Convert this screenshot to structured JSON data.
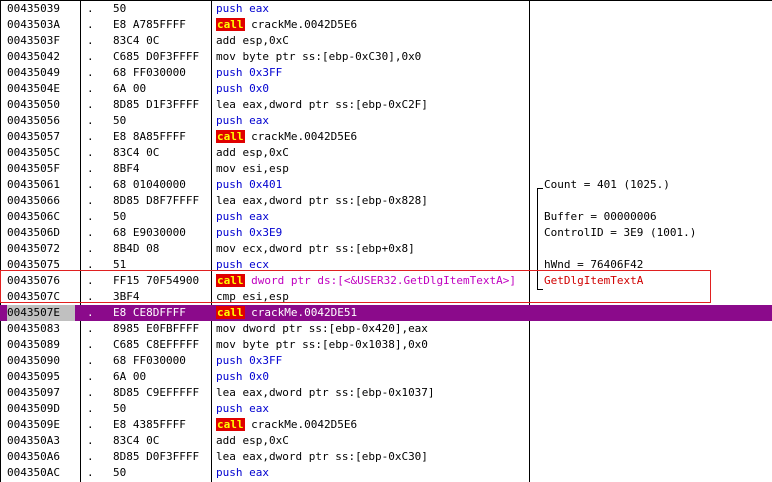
{
  "rows": [
    {
      "addr": "00435039",
      "mark": ".",
      "hex": "50",
      "mn": "push",
      "ops": "eax",
      "kind": "push"
    },
    {
      "addr": "0043503A",
      "mark": ".",
      "hex": "E8 A785FFFF",
      "mn": "call",
      "ops": "crackMe.0042D5E6",
      "kind": "call"
    },
    {
      "addr": "0043503F",
      "mark": ".",
      "hex": "83C4 0C",
      "mn": "add",
      "ops": "esp,0xC",
      "kind": "normal"
    },
    {
      "addr": "00435042",
      "mark": ".",
      "hex": "C685 D0F3FFFF",
      "mn": "mov",
      "ops": "byte ptr ss:[ebp-0xC30],0x0",
      "kind": "normal"
    },
    {
      "addr": "00435049",
      "mark": ".",
      "hex": "68 FF030000",
      "mn": "push",
      "ops": "0x3FF",
      "kind": "push"
    },
    {
      "addr": "0043504E",
      "mark": ".",
      "hex": "6A 00",
      "mn": "push",
      "ops": "0x0",
      "kind": "push"
    },
    {
      "addr": "00435050",
      "mark": ".",
      "hex": "8D85 D1F3FFFF",
      "mn": "lea",
      "ops": "eax,dword ptr ss:[ebp-0xC2F]",
      "kind": "normal"
    },
    {
      "addr": "00435056",
      "mark": ".",
      "hex": "50",
      "mn": "push",
      "ops": "eax",
      "kind": "push"
    },
    {
      "addr": "00435057",
      "mark": ".",
      "hex": "E8 8A85FFFF",
      "mn": "call",
      "ops": "crackMe.0042D5E6",
      "kind": "call"
    },
    {
      "addr": "0043505C",
      "mark": ".",
      "hex": "83C4 0C",
      "mn": "add",
      "ops": "esp,0xC",
      "kind": "normal"
    },
    {
      "addr": "0043505F",
      "mark": ".",
      "hex": "8BF4",
      "mn": "mov",
      "ops": "esi,esp",
      "kind": "normal"
    },
    {
      "addr": "00435061",
      "mark": ".",
      "hex": "68 01040000",
      "mn": "push",
      "ops": "0x401",
      "kind": "push",
      "comment": "Count = 401 (1025.)"
    },
    {
      "addr": "00435066",
      "mark": ".",
      "hex": "8D85 D8F7FFFF",
      "mn": "lea",
      "ops": "eax,dword ptr ss:[ebp-0x828]",
      "kind": "normal"
    },
    {
      "addr": "0043506C",
      "mark": ".",
      "hex": "50",
      "mn": "push",
      "ops": "eax",
      "kind": "push",
      "comment": "Buffer = 00000006"
    },
    {
      "addr": "0043506D",
      "mark": ".",
      "hex": "68 E9030000",
      "mn": "push",
      "ops": "0x3E9",
      "kind": "push",
      "comment": "ControlID = 3E9 (1001.)"
    },
    {
      "addr": "00435072",
      "mark": ".",
      "hex": "8B4D 08",
      "mn": "mov",
      "ops": "ecx,dword ptr ss:[ebp+0x8]",
      "kind": "normal"
    },
    {
      "addr": "00435075",
      "mark": ".",
      "hex": "51",
      "mn": "push",
      "ops": "ecx",
      "kind": "push",
      "comment": "hWnd = 76406F42"
    },
    {
      "addr": "00435076",
      "mark": ".",
      "hex": "FF15 70F54900",
      "mn": "call",
      "ops": "dword ptr ds:[<&USER32.GetDlgItemTextA>]",
      "kind": "call-api",
      "comment": "GetDlgItemTextA",
      "comment_kind": "api"
    },
    {
      "addr": "0043507C",
      "mark": ".",
      "hex": "3BF4",
      "mn": "cmp",
      "ops": "esi,esp",
      "kind": "normal"
    },
    {
      "addr": "0043507E",
      "mark": ".",
      "hex": "E8 CE8DFFFF",
      "mn": "call",
      "ops": "crackMe.0042DE51",
      "kind": "call",
      "selected": true
    },
    {
      "addr": "00435083",
      "mark": ".",
      "hex": "8985 E0FBFFFF",
      "mn": "mov",
      "ops": "dword ptr ss:[ebp-0x420],eax",
      "kind": "normal"
    },
    {
      "addr": "00435089",
      "mark": ".",
      "hex": "C685 C8EFFFFF",
      "mn": "mov",
      "ops": "byte ptr ss:[ebp-0x1038],0x0",
      "kind": "normal"
    },
    {
      "addr": "00435090",
      "mark": ".",
      "hex": "68 FF030000",
      "mn": "push",
      "ops": "0x3FF",
      "kind": "push"
    },
    {
      "addr": "00435095",
      "mark": ".",
      "hex": "6A 00",
      "mn": "push",
      "ops": "0x0",
      "kind": "push"
    },
    {
      "addr": "00435097",
      "mark": ".",
      "hex": "8D85 C9EFFFFF",
      "mn": "lea",
      "ops": "eax,dword ptr ss:[ebp-0x1037]",
      "kind": "normal"
    },
    {
      "addr": "0043509D",
      "mark": ".",
      "hex": "50",
      "mn": "push",
      "ops": "eax",
      "kind": "push"
    },
    {
      "addr": "0043509E",
      "mark": ".",
      "hex": "E8 4385FFFF",
      "mn": "call",
      "ops": "crackMe.0042D5E6",
      "kind": "call"
    },
    {
      "addr": "004350A3",
      "mark": ".",
      "hex": "83C4 0C",
      "mn": "add",
      "ops": "esp,0xC",
      "kind": "normal"
    },
    {
      "addr": "004350A6",
      "mark": ".",
      "hex": "8D85 D0F3FFFF",
      "mn": "lea",
      "ops": "eax,dword ptr ss:[ebp-0xC30]",
      "kind": "normal"
    },
    {
      "addr": "004350AC",
      "mark": ".",
      "hex": "50",
      "mn": "push",
      "ops": "eax",
      "kind": "push"
    }
  ],
  "colors": {
    "push": "#0000d0",
    "call_bg": "#e00000",
    "call_fg": "#ffff00",
    "api": "#c000c0",
    "selected_row": "#8b0a8b",
    "highlight_box": "#e02020"
  }
}
